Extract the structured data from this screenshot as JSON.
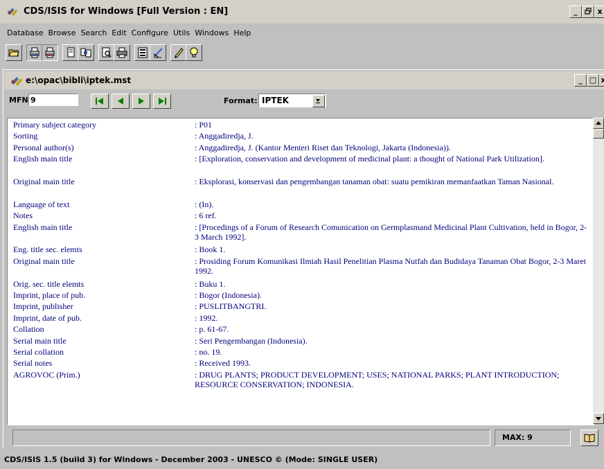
{
  "app": {
    "title": "CDS/ISIS for Windows [Full Version : EN]",
    "min": "_",
    "restore": "А",
    "close": "x"
  },
  "menu": [
    "Database",
    "Browse",
    "Search",
    "Edit",
    "Configure",
    "Utils",
    "Windows",
    "Help"
  ],
  "toolbar_icons": [
    "open-folder-icon",
    "print-txt-icon",
    "print-rtf-icon",
    "copy-icon",
    "merge-icon",
    "preview-icon",
    "printer-icon",
    "form-icon",
    "edit-icon",
    "pencil-icon",
    "lightbulb-icon"
  ],
  "child": {
    "title": "e:\\opac\\bibli\\iptek.mst",
    "min": "_",
    "max": "□",
    "close": "x"
  },
  "nav": {
    "mfn_label": "MFN",
    "mfn_value": "9",
    "format_label": "Format:",
    "format_value": "IPTEK"
  },
  "record": [
    {
      "label": "Primary subject category",
      "value": ": P01"
    },
    {
      "label": "Sorting",
      "value": ": Anggadiredja, J."
    },
    {
      "label": "Personal author(s)",
      "value": ": Anggadiredja, J. (Kantor Menteri Riset dan Teknologi, Jakarta (Indonesia))."
    },
    {
      "label": "English main title",
      "value": ": [Exploration, conservation and development of medicinal plant: a thought of National Park Utilization]."
    },
    {
      "label": "Original main title",
      "value": ": Eksplorasi, konservasi dan pengembangan tanaman obat: suatu pemikiran memanfaatkan Taman Nasional."
    },
    {
      "label": "Language of text",
      "value": ": (In)."
    },
    {
      "label": "Notes",
      "value": ": 6 ref."
    },
    {
      "label": "English main title",
      "value": ": [Procedings of a Forum of Research Comunication on Germplasmand Medicinal Plant Cultivation, held in Bogor, 2-3 March 1992]."
    },
    {
      "label": "Eng. title sec. elemts",
      "value": ": Book 1."
    },
    {
      "label": "Original main title",
      "value": ": Prosiding Forum Komunikasi Ilmiah Hasil Penelitian Plasma Nutfah dan Budidaya Tanaman Obat Bogor, 2-3 Maret 1992."
    },
    {
      "label": "Orig. sec. title elemts",
      "value": ": Buku 1."
    },
    {
      "label": "Imprint, place of pub.",
      "value": ": Bogor (Indonesia)."
    },
    {
      "label": "Imprint, publisher",
      "value": ": PUSLITBANGTRI."
    },
    {
      "label": "Imprint, date of pub.",
      "value": ": 1992."
    },
    {
      "label": "Collation",
      "value": ": p. 61-67."
    },
    {
      "label": "Serial main title",
      "value": ": Seri Pengembangan (Indonesia)."
    },
    {
      "label": "Serial collation",
      "value": ": no. 19."
    },
    {
      "label": "Serial notes",
      "value": ": Received 1993."
    },
    {
      "label": "AGROVOC (Prim.)",
      "value": ": DRUG PLANTS; PRODUCT DEVELOPMENT; USES; NATIONAL PARKS; PLANT INTRODUCTION; RESOURCE CONSERVATION; INDONESIA."
    }
  ],
  "status": {
    "message": "",
    "max": "MAX: 9"
  },
  "footer": "CDS/ISIS 1.5 (build 3) for Windows - December 2003 - UNESCO © (Mode: SINGLE USER)"
}
